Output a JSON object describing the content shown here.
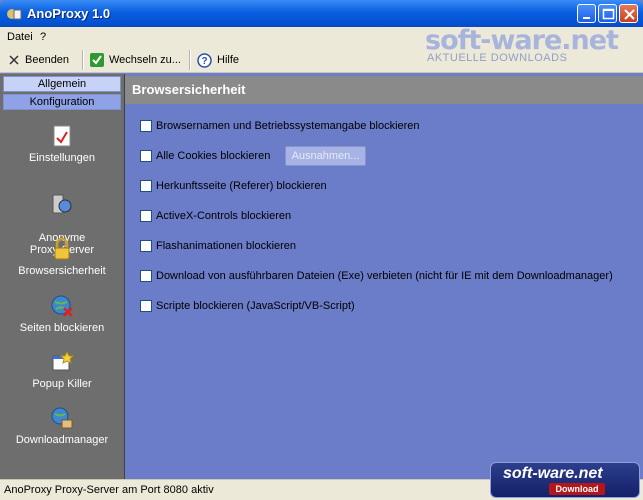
{
  "window": {
    "title": "AnoProxy 1.0"
  },
  "menu": {
    "items": [
      "Datei",
      "?"
    ]
  },
  "toolbar": {
    "exit_label": "Beenden",
    "switch_label": "Wechseln zu...",
    "help_label": "Hilfe"
  },
  "watermark": {
    "main": "soft-ware.net",
    "sub": "AKTUELLE DOWNLOADS"
  },
  "sidebar": {
    "tabs": [
      "Allgemein",
      "Konfiguration"
    ],
    "items": [
      {
        "label": "Einstellungen",
        "icon": "settings-icon"
      },
      {
        "label": "Anonyme\nProxy-Server",
        "icon": "proxy-server-icon"
      },
      {
        "label": "Browsersicherheit",
        "icon": "lock-icon"
      },
      {
        "label": "Seiten blockieren",
        "icon": "globe-block-icon"
      },
      {
        "label": "Popup Killer",
        "icon": "popup-icon"
      },
      {
        "label": "Downloadmanager",
        "icon": "download-icon"
      }
    ]
  },
  "content": {
    "title": "Browsersicherheit",
    "options": [
      {
        "label": "Browsernamen und Betriebssystemangabe blockieren",
        "checked": false
      },
      {
        "label": "Alle Cookies blockieren",
        "checked": false
      },
      {
        "label": "Herkunftsseite (Referer) blockieren",
        "checked": false
      },
      {
        "label": "ActiveX-Controls blockieren",
        "checked": false
      },
      {
        "label": "Flashanimationen blockieren",
        "checked": false
      },
      {
        "label": "Download von ausführbaren Dateien (Exe) verbieten (nicht für IE mit dem Downloadmanager)",
        "checked": false
      },
      {
        "label": "Scripte blockieren (JavaScript/VB-Script)",
        "checked": false
      }
    ],
    "exceptions_button": "Ausnahmen..."
  },
  "status": {
    "text": "AnoProxy Proxy-Server am Port 8080 aktiv"
  },
  "badge": {
    "main": "soft-ware.net",
    "sub": "Download"
  }
}
